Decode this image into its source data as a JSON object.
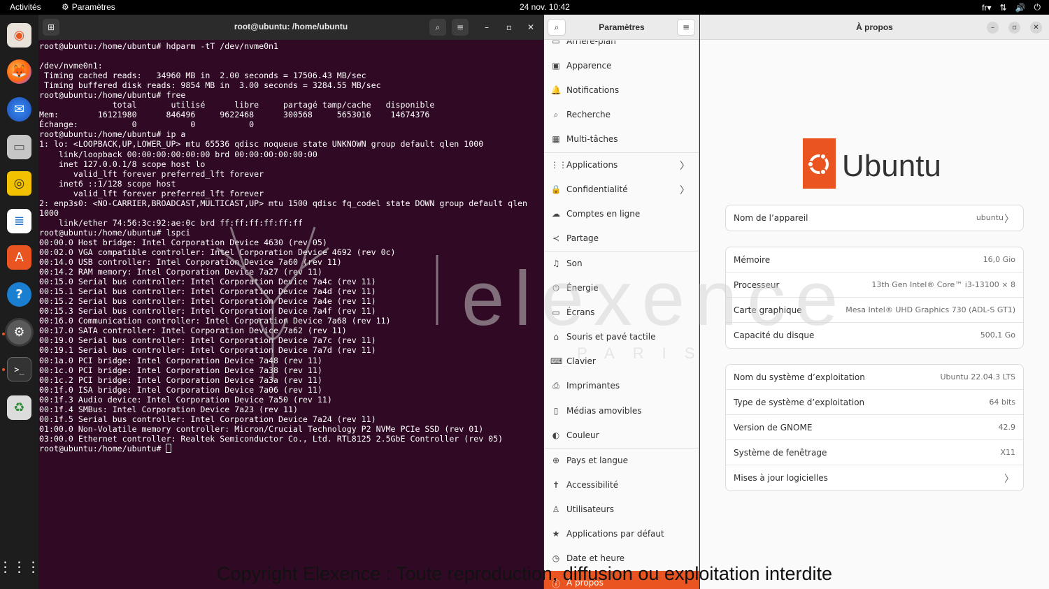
{
  "topbar": {
    "activities": "Activités",
    "app_name": "Paramètres",
    "clock": "24 nov.  10:42",
    "keyboard_layout": "fr"
  },
  "dock": {
    "items": [
      "firefox",
      "thunderbird",
      "files",
      "rhythmbox",
      "writer",
      "software",
      "help",
      "settings",
      "terminal",
      "trash"
    ]
  },
  "terminal": {
    "title": "root@ubuntu: /home/ubuntu",
    "lines": [
      "root@ubuntu:/home/ubuntu# hdparm -tT /dev/nvme0n1",
      "",
      "/dev/nvme0n1:",
      " Timing cached reads:   34960 MB in  2.00 seconds = 17506.43 MB/sec",
      " Timing buffered disk reads: 9854 MB in  3.00 seconds = 3284.55 MB/sec",
      "root@ubuntu:/home/ubuntu# free",
      "               total       utilisé      libre     partagé tamp/cache   disponible",
      "Mem:        16121980      846496     9622468      300568     5653016    14674376",
      "Échange:           0           0           0",
      "root@ubuntu:/home/ubuntu# ip a",
      "1: lo: <LOOPBACK,UP,LOWER_UP> mtu 65536 qdisc noqueue state UNKNOWN group default qlen 1000",
      "    link/loopback 00:00:00:00:00:00 brd 00:00:00:00:00:00",
      "    inet 127.0.0.1/8 scope host lo",
      "       valid_lft forever preferred_lft forever",
      "    inet6 ::1/128 scope host",
      "       valid_lft forever preferred_lft forever",
      "2: enp3s0: <NO-CARRIER,BROADCAST,MULTICAST,UP> mtu 1500 qdisc fq_codel state DOWN group default qlen",
      "1000",
      "    link/ether 74:56:3c:92:ae:0c brd ff:ff:ff:ff:ff:ff",
      "root@ubuntu:/home/ubuntu# lspci",
      "00:00.0 Host bridge: Intel Corporation Device 4630 (rev 05)",
      "00:02.0 VGA compatible controller: Intel Corporation Device 4692 (rev 0c)",
      "00:14.0 USB controller: Intel Corporation Device 7a60 (rev 11)",
      "00:14.2 RAM memory: Intel Corporation Device 7a27 (rev 11)",
      "00:15.0 Serial bus controller: Intel Corporation Device 7a4c (rev 11)",
      "00:15.1 Serial bus controller: Intel Corporation Device 7a4d (rev 11)",
      "00:15.2 Serial bus controller: Intel Corporation Device 7a4e (rev 11)",
      "00:15.3 Serial bus controller: Intel Corporation Device 7a4f (rev 11)",
      "00:16.0 Communication controller: Intel Corporation Device 7a68 (rev 11)",
      "00:17.0 SATA controller: Intel Corporation Device 7a62 (rev 11)",
      "00:19.0 Serial bus controller: Intel Corporation Device 7a7c (rev 11)",
      "00:19.1 Serial bus controller: Intel Corporation Device 7a7d (rev 11)",
      "00:1a.0 PCI bridge: Intel Corporation Device 7a48 (rev 11)",
      "00:1c.0 PCI bridge: Intel Corporation Device 7a38 (rev 11)",
      "00:1c.2 PCI bridge: Intel Corporation Device 7a3a (rev 11)",
      "00:1f.0 ISA bridge: Intel Corporation Device 7a06 (rev 11)",
      "00:1f.3 Audio device: Intel Corporation Device 7a50 (rev 11)",
      "00:1f.4 SMBus: Intel Corporation Device 7a23 (rev 11)",
      "00:1f.5 Serial bus controller: Intel Corporation Device 7a24 (rev 11)",
      "01:00.0 Non-Volatile memory controller: Micron/Crucial Technology P2 NVMe PCIe SSD (rev 01)",
      "03:00.0 Ethernet controller: Realtek Semiconductor Co., Ltd. RTL8125 2.5GbE Controller (rev 05)"
    ],
    "prompt": "root@ubuntu:/home/ubuntu# "
  },
  "settings": {
    "title": "Paramètres",
    "items": [
      {
        "label": "Arrière-plan",
        "icon": "background-icon"
      },
      {
        "label": "Apparence",
        "icon": "appearance-icon"
      },
      {
        "label": "Notifications",
        "icon": "bell-icon"
      },
      {
        "label": "Recherche",
        "icon": "search-icon"
      },
      {
        "label": "Multi-tâches",
        "icon": "multitasking-icon"
      },
      {
        "label": "Applications",
        "icon": "apps-grid-icon",
        "chevron": true
      },
      {
        "label": "Confidentialité",
        "icon": "lock-icon",
        "chevron": true
      },
      {
        "label": "Comptes en ligne",
        "icon": "cloud-icon"
      },
      {
        "label": "Partage",
        "icon": "share-icon"
      },
      {
        "label": "Son",
        "icon": "music-note-icon"
      },
      {
        "label": "Énergie",
        "icon": "power-icon"
      },
      {
        "label": "Écrans",
        "icon": "display-icon"
      },
      {
        "label": "Souris et pavé tactile",
        "icon": "mouse-icon"
      },
      {
        "label": "Clavier",
        "icon": "keyboard-icon"
      },
      {
        "label": "Imprimantes",
        "icon": "printer-icon"
      },
      {
        "label": "Médias amovibles",
        "icon": "usb-icon"
      },
      {
        "label": "Couleur",
        "icon": "color-icon"
      },
      {
        "label": "Pays et langue",
        "icon": "globe-icon"
      },
      {
        "label": "Accessibilité",
        "icon": "accessibility-icon"
      },
      {
        "label": "Utilisateurs",
        "icon": "users-icon"
      },
      {
        "label": "Applications par défaut",
        "icon": "star-icon"
      },
      {
        "label": "Date et heure",
        "icon": "clock-icon"
      },
      {
        "label": "À propos",
        "icon": "info-icon",
        "active": true
      }
    ]
  },
  "about": {
    "title": "À propos",
    "logo_text": "Ubuntu",
    "device_group": [
      {
        "key": "Nom de l’appareil",
        "value": "ubuntu",
        "chevron": true
      }
    ],
    "hardware_group": [
      {
        "key": "Mémoire",
        "value": "16,0 Gio"
      },
      {
        "key": "Processeur",
        "value": "13th Gen Intel® Core™ i3-13100 × 8"
      },
      {
        "key": "Carte graphique",
        "value": "Mesa Intel® UHD Graphics 730 (ADL-S GT1)"
      },
      {
        "key": "Capacité du disque",
        "value": "500,1 Go"
      }
    ],
    "os_group": [
      {
        "key": "Nom du système d’exploitation",
        "value": "Ubuntu 22.04.3 LTS"
      },
      {
        "key": "Type de système d’exploitation",
        "value": "64 bits"
      },
      {
        "key": "Version de GNOME",
        "value": "42.9"
      },
      {
        "key": "Système de fenêtrage",
        "value": "X11"
      },
      {
        "key": "Mises à jour logicielles",
        "value": "",
        "chevron": true
      }
    ]
  },
  "watermark": {
    "brand": "elexence",
    "sub": "PARIS",
    "copyright": "Copyright Elexence : Toute reproduction, diffusion ou exploitation interdite"
  },
  "colors": {
    "accent": "#e95420",
    "terminal_bg": "#300a24"
  }
}
